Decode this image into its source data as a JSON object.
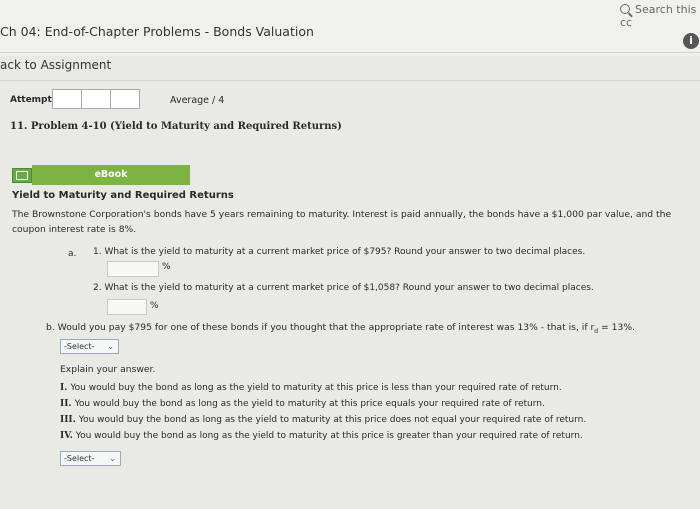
{
  "header": {
    "search_placeholder": "Search this cc",
    "title": "Ch 04: End-of-Chapter Problems - Bonds Valuation",
    "back_link": "ack to Assignment"
  },
  "assignment": {
    "attempts_label": "Attempts",
    "average_label": "Average / 4",
    "problem_title": "11. Problem 4-10 (Yield to Maturity and Required Returns)"
  },
  "ebook": {
    "label": "eBook"
  },
  "content": {
    "section_title": "Yield to Maturity and Required Returns",
    "paragraph": "The Brownstone Corporation's bonds have 5 years remaining to maturity. Interest is paid annually, the bonds have a $1,000 par value, and the coupon interest rate is 8%.",
    "part_a_label": "a.",
    "q1": "1. What is the yield to maturity at a current market price of $795? Round your answer to two decimal places.",
    "q1_unit": "%",
    "q2": "2. What is the yield to maturity at a current market price of $1,058? Round your answer to two decimal places.",
    "q2_unit": "%",
    "qb": "b. Would you pay $795 for one of these bonds if you thought that the appropriate rate of interest was 13% - that is, if r",
    "qb_sub": "d",
    "qb_tail": " = 13%.",
    "select1": "-Select-",
    "explain_label": "Explain your answer.",
    "options": [
      {
        "num": "I.",
        "text": "You would buy the bond as long as the yield to maturity at this price is less than your required rate of return."
      },
      {
        "num": "II.",
        "text": "You would buy the bond as long as the yield to maturity at this price equals your required rate of return."
      },
      {
        "num": "III.",
        "text": "You would buy the bond as long as the yield to maturity at this price does not equal your required rate of return."
      },
      {
        "num": "IV.",
        "text": "You would buy the bond as long as the yield to maturity at this price is greater than your required rate of return."
      }
    ],
    "select2": "-Select-"
  }
}
